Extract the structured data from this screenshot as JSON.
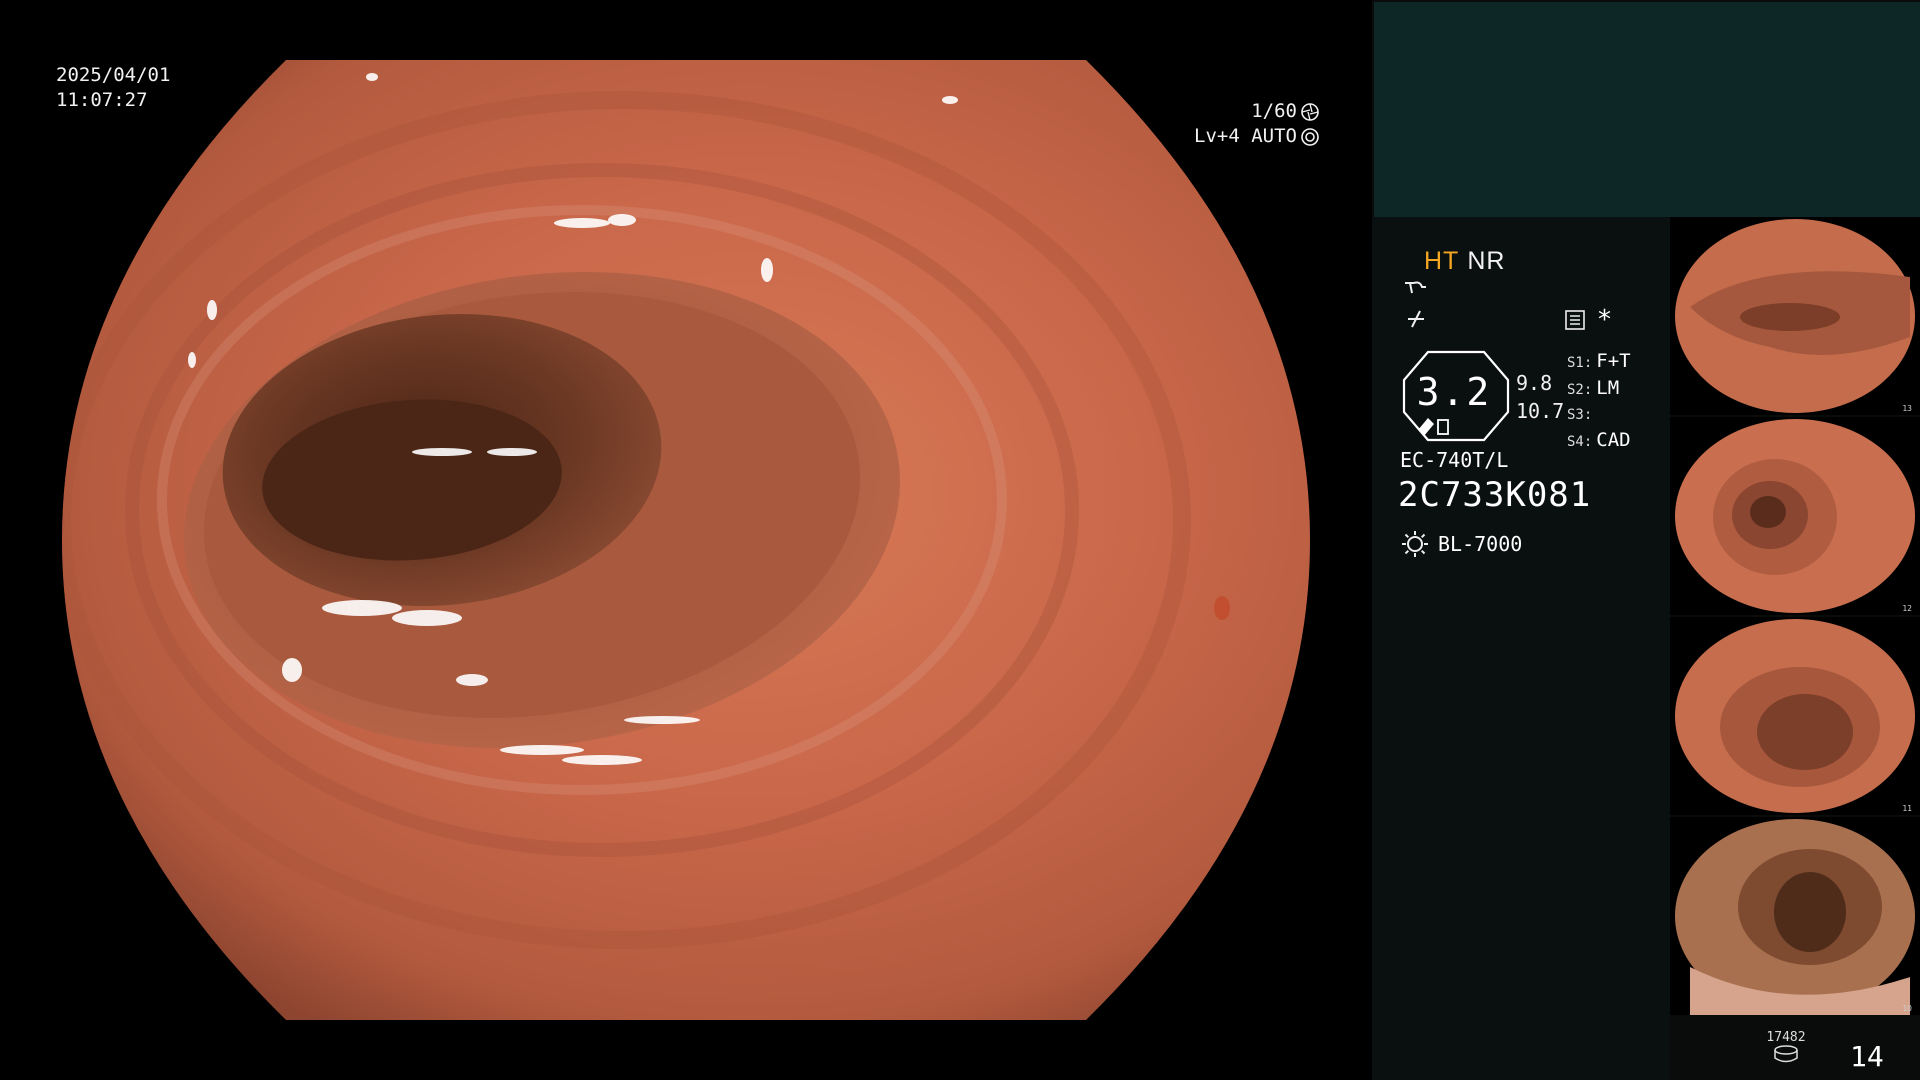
{
  "osd": {
    "date": "2025/04/01",
    "time": "11:07:27",
    "shutter": "1/60",
    "level_mode": "Lv+4 AUTO"
  },
  "status": {
    "mode_ht": "HT",
    "mode_nr": "NR",
    "star": "*",
    "zoom": "3.2",
    "num_upper": "9.8",
    "num_lower": "10.7",
    "slots": [
      {
        "key": "S1:",
        "value": "F+T"
      },
      {
        "key": "S2:",
        "value": "LM"
      },
      {
        "key": "S3:",
        "value": ""
      },
      {
        "key": "S4:",
        "value": "CAD"
      }
    ],
    "scope_model": "EC-740T/L",
    "scope_serial": "2C733K081",
    "light_source": "BL-7000"
  },
  "thumbnails": [
    {
      "index": "13"
    },
    {
      "index": "12"
    },
    {
      "index": "11"
    },
    {
      "index": "10"
    }
  ],
  "footer": {
    "counter": "17482",
    "page": "14"
  },
  "colors": {
    "mucosa": "#c9674a",
    "lumen": "#5e3220",
    "ht_accent": "#f5a623",
    "panel_top": "#0d2626"
  }
}
